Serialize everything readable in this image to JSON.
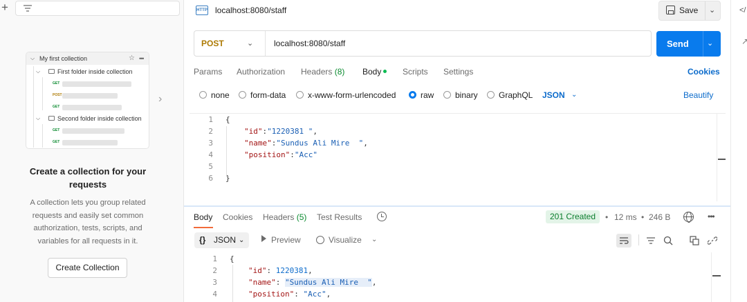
{
  "sidebar": {
    "illustration": {
      "collection": "My first collection",
      "folder1": "First folder inside collection",
      "folder2": "Second folder inside collection",
      "methods": [
        "GET",
        "POST",
        "GET",
        "GET",
        "GET"
      ]
    },
    "empty_title": "Create a collection for your requests",
    "empty_desc": "A collection lets you group related requests and easily set common authorization, tests, scripts, and variables for all requests in it.",
    "create_button": "Create Collection"
  },
  "request": {
    "title": "localhost:8080/staff",
    "http_badge": "HTTP",
    "save_label": "Save",
    "method": "POST",
    "url": "localhost:8080/staff",
    "send_label": "Send",
    "tabs": {
      "params": "Params",
      "authorization": "Authorization",
      "headers": "Headers",
      "headers_count": "(8)",
      "body": "Body",
      "scripts": "Scripts",
      "settings": "Settings"
    },
    "cookies_link": "Cookies",
    "body_types": {
      "none": "none",
      "form_data": "form-data",
      "urlencoded": "x-www-form-urlencoded",
      "raw": "raw",
      "binary": "binary",
      "graphql": "GraphQL"
    },
    "body_format": "JSON",
    "beautify": "Beautify",
    "body_lines": [
      {
        "num": "1",
        "text": "{"
      },
      {
        "num": "2",
        "key": "\"id\"",
        "sep": ":",
        "val": "\"1220381 \"",
        "end": ","
      },
      {
        "num": "3",
        "key": "\"name\"",
        "sep": ":",
        "val": "\"Sundus Ali Mire  \"",
        "end": ","
      },
      {
        "num": "4",
        "key": "\"position\"",
        "sep": ":",
        "val": "\"Acc\"",
        "end": ""
      },
      {
        "num": "5",
        "text": ""
      },
      {
        "num": "6",
        "text": "}"
      }
    ]
  },
  "response": {
    "tabs": {
      "body": "Body",
      "cookies": "Cookies",
      "headers": "Headers",
      "headers_count": "(5)",
      "test_results": "Test Results"
    },
    "status": "201 Created",
    "time": "12 ms",
    "size": "246 B",
    "format": "JSON",
    "format_brace": "{}",
    "preview": "Preview",
    "visualize": "Visualize",
    "lines": [
      {
        "num": "1",
        "text": "{"
      },
      {
        "num": "2",
        "key": "\"id\"",
        "sep": ": ",
        "val": "1220381",
        "end": ","
      },
      {
        "num": "3",
        "key": "\"name\"",
        "sep": ": ",
        "val": "\"Sundus Ali Mire  \"",
        "end": ","
      },
      {
        "num": "4",
        "key": "\"position\"",
        "sep": ": ",
        "val": "\"Acc\"",
        "end": ","
      }
    ]
  },
  "colors": {
    "accent": "#097bed",
    "post_method": "#ad7a03",
    "status_ok": "#0a7d2c",
    "tab_active_underline": "#f26b3a"
  },
  "icons": [
    "plus-icon",
    "filter-icon",
    "chevron-right-icon",
    "http-icon",
    "save-icon",
    "code-icon",
    "history-icon",
    "globe-icon",
    "more-icon",
    "wrap-icon",
    "filter-lines-icon",
    "search-icon",
    "copy-icon",
    "link-icon"
  ]
}
